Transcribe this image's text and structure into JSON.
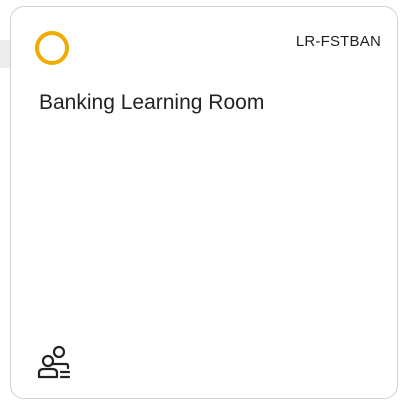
{
  "card": {
    "code": "LR-FSTBAN",
    "title": "Banking Learning Room",
    "status_icon": "status-ring-icon",
    "status_color": "#f0ad00",
    "members_icon": "users-icon"
  }
}
